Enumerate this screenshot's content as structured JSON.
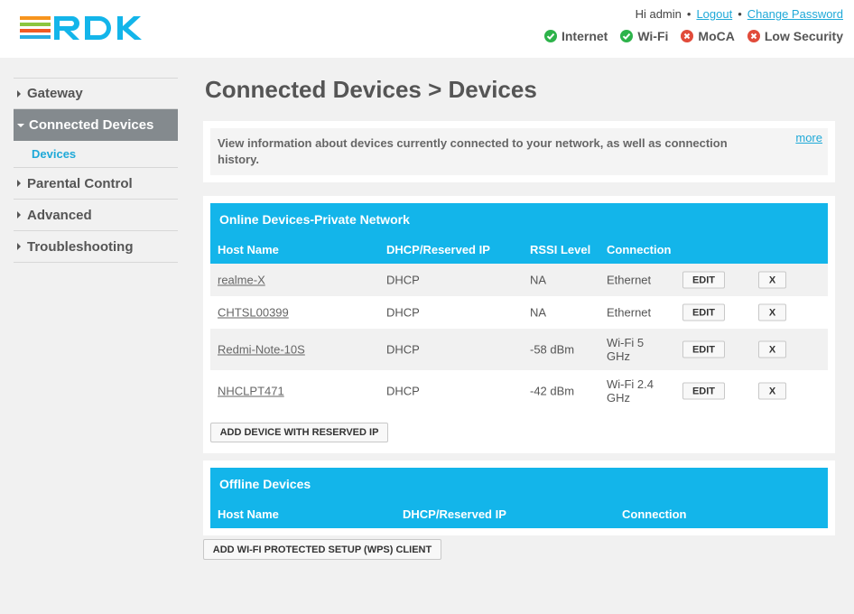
{
  "header": {
    "greeting": "Hi admin",
    "logout": "Logout",
    "change_password": "Change Password",
    "statuses": [
      {
        "label": "Internet",
        "state": "ok"
      },
      {
        "label": "Wi-Fi",
        "state": "ok"
      },
      {
        "label": "MoCA",
        "state": "error"
      },
      {
        "label": "Low Security",
        "state": "error"
      }
    ],
    "colors": {
      "ok": "#2db34a",
      "error": "#e14b3a",
      "link": "#1fa9d8"
    }
  },
  "sidebar": {
    "items": [
      {
        "label": "Gateway"
      },
      {
        "label": "Connected Devices"
      },
      {
        "label": "Devices"
      },
      {
        "label": "Parental Control"
      },
      {
        "label": "Advanced"
      },
      {
        "label": "Troubleshooting"
      }
    ]
  },
  "main": {
    "title": "Connected Devices > Devices",
    "info": "View information about devices currently connected to your network, as well as connection history.",
    "more": "more",
    "online": {
      "title": "Online Devices-Private Network",
      "headers": [
        "Host Name",
        "DHCP/Reserved IP",
        "RSSI Level",
        "Connection"
      ],
      "rows": [
        {
          "host": "realme-X",
          "ip": "DHCP",
          "rssi": "NA",
          "conn": "Ethernet"
        },
        {
          "host": "CHTSL00399",
          "ip": "DHCP",
          "rssi": "NA",
          "conn": "Ethernet"
        },
        {
          "host": "Redmi-Note-10S",
          "ip": "DHCP",
          "rssi": "-58 dBm",
          "conn": "Wi-Fi 5 GHz"
        },
        {
          "host": "NHCLPT471",
          "ip": "DHCP",
          "rssi": "-42 dBm",
          "conn": "Wi-Fi 2.4 GHz"
        }
      ],
      "edit_label": "EDIT",
      "delete_label": "X",
      "add_label": "ADD DEVICE WITH RESERVED IP"
    },
    "offline": {
      "title": "Offline Devices",
      "headers": [
        "Host Name",
        "DHCP/Reserved IP",
        "Connection"
      ]
    },
    "wps_label": "ADD WI-FI PROTECTED SETUP (WPS) CLIENT",
    "accent": "#13b5ea"
  }
}
